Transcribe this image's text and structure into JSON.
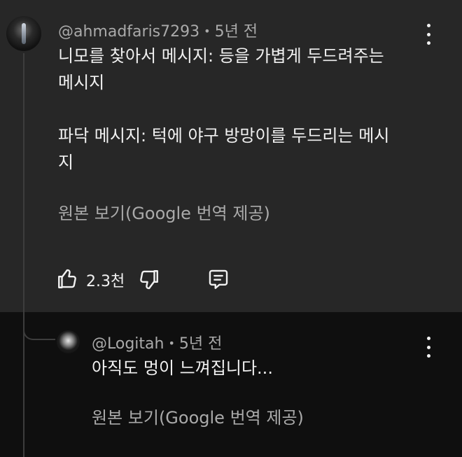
{
  "comment": {
    "author": "@ahmadfaris7293",
    "separator": "•",
    "time": "5년 전",
    "text": "니모를 찾아서 메시지: 등을 가볍게 두드려주는\n메시지\n\n파닥 메시지: 턱에 야구 방망이를 두드리는 메시\n지",
    "translate": "원본 보기(Google 번역 제공)",
    "like_count": "2.3천"
  },
  "reply": {
    "author": "@Logitah",
    "separator": "•",
    "time": "5년 전",
    "text": "아직도 멍이 느껴집니다...",
    "translate": "원본 보기(Google 번역 제공)"
  },
  "icons": {
    "more": "more-vert-icon",
    "like": "thumbs-up-icon",
    "dislike": "thumbs-down-icon",
    "reply": "comment-reply-icon"
  },
  "colors": {
    "main_bg": "#272727",
    "reply_bg": "#0f0f0f",
    "text": "#f1f1f1",
    "secondary": "#aaaaaa"
  }
}
